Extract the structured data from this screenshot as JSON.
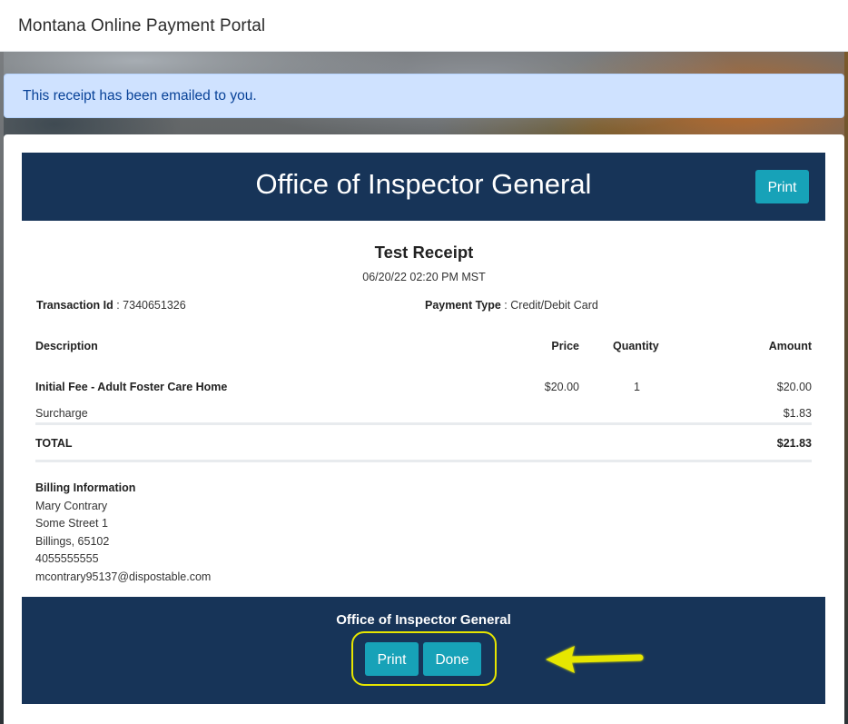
{
  "header": {
    "brand": "Montana Online Payment Portal"
  },
  "alert": {
    "message": "This receipt has been emailed to you."
  },
  "banner": {
    "title": "Office of Inspector General",
    "print_label": "Print"
  },
  "receipt": {
    "title": "Test Receipt",
    "datetime": "06/20/22 02:20 PM MST",
    "transaction_label": "Transaction Id",
    "transaction_id": "7340651326",
    "payment_type_label": "Payment Type",
    "payment_type": "Credit/Debit Card",
    "columns": {
      "description": "Description",
      "price": "Price",
      "quantity": "Quantity",
      "amount": "Amount"
    },
    "line_items": [
      {
        "description": "Initial Fee - Adult Foster Care Home",
        "price": "$20.00",
        "quantity": "1",
        "amount": "$20.00"
      }
    ],
    "surcharge_label": "Surcharge",
    "surcharge_amount": "$1.83",
    "total_label": "TOTAL",
    "total_amount": "$21.83"
  },
  "billing": {
    "heading": "Billing Information",
    "name": "Mary Contrary",
    "street": "Some Street 1",
    "city_zip": "Billings, 65102",
    "phone": "4055555555",
    "email": "mcontrary95137@dispostable.com"
  },
  "footer": {
    "title": "Office of Inspector General",
    "print_label": "Print",
    "done_label": "Done"
  },
  "colors": {
    "navy": "#173458",
    "teal_button": "#17a2b8",
    "alert_bg": "#cfe2ff",
    "highlight": "#e6e600"
  }
}
